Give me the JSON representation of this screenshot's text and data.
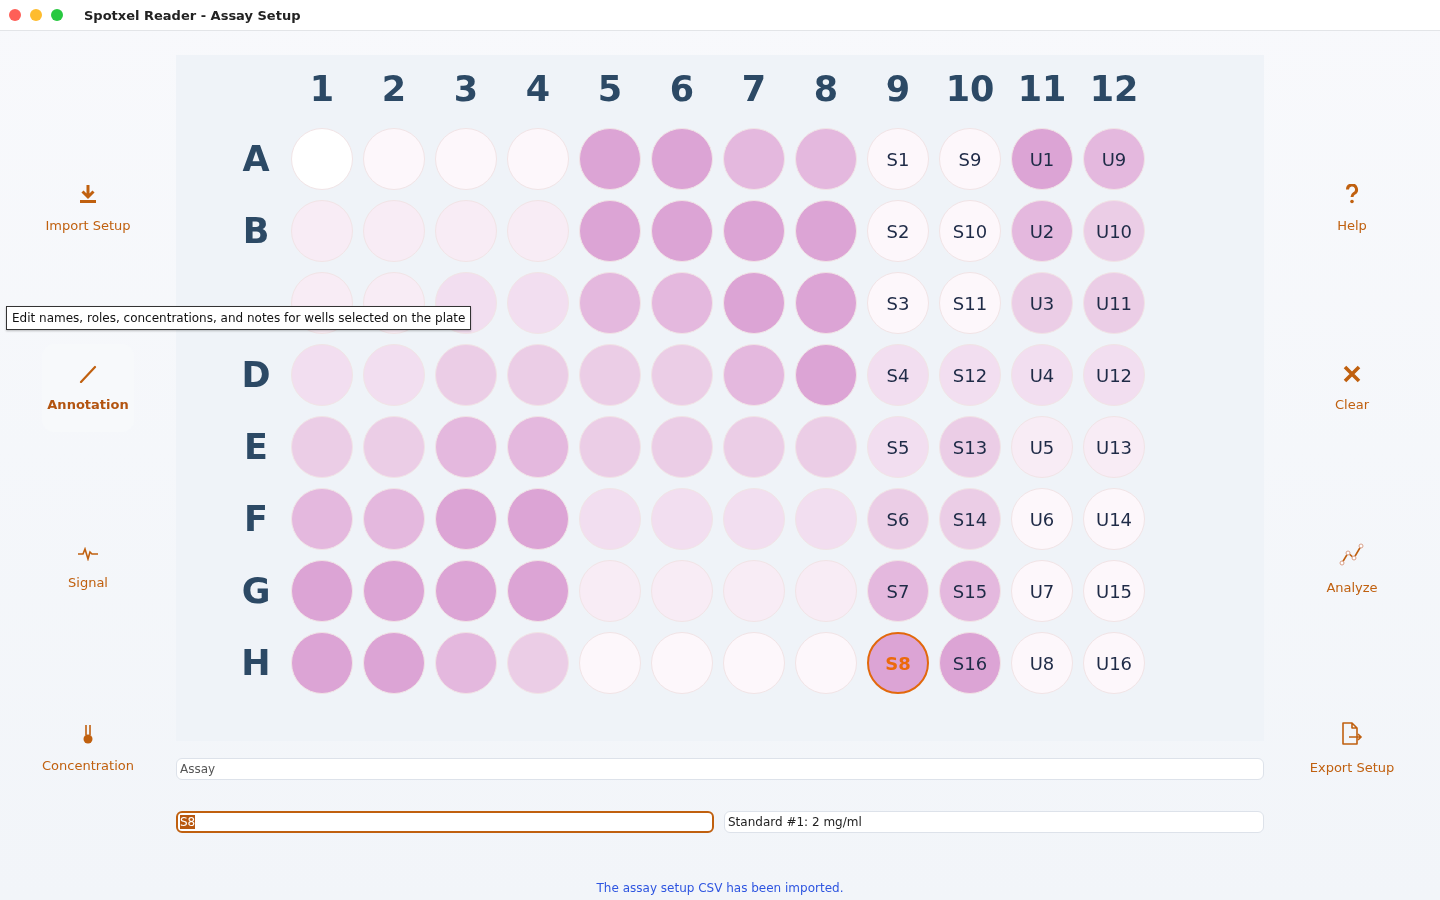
{
  "window": {
    "title": "Spotxel Reader - Assay Setup"
  },
  "left_sidebar": [
    {
      "label": "Import Setup",
      "selected": false
    },
    {
      "label": "Annotation",
      "selected": true
    },
    {
      "label": "Signal",
      "selected": false
    },
    {
      "label": "Concentration",
      "selected": false
    }
  ],
  "right_sidebar": [
    {
      "label": "Help",
      "selected": false
    },
    {
      "label": "Clear",
      "selected": false
    },
    {
      "label": "Analyze",
      "selected": false
    },
    {
      "label": "Export Setup",
      "selected": false
    }
  ],
  "plate": {
    "columns": [
      "1",
      "2",
      "3",
      "4",
      "5",
      "6",
      "7",
      "8",
      "9",
      "10",
      "11",
      "12"
    ],
    "rows": [
      {
        "label": "A",
        "wells": [
          {
            "color": "#ffffff",
            "selected": false
          },
          {
            "color": "#fdf7fb",
            "selected": false
          },
          {
            "color": "#fdf7fb",
            "selected": false
          },
          {
            "color": "#fdf7fb",
            "selected": false
          },
          {
            "color": "#dca4d5",
            "selected": false
          },
          {
            "color": "#dca4d5",
            "selected": false
          },
          {
            "color": "#e4b8de",
            "selected": false
          },
          {
            "color": "#e4b8de",
            "selected": false
          },
          {
            "label": "S1",
            "color": "#fdf7fb",
            "selected": false
          },
          {
            "label": "S9",
            "color": "#fdf7fb",
            "selected": false
          },
          {
            "label": "U1",
            "color": "#dca4d5",
            "selected": false
          },
          {
            "label": "U9",
            "color": "#e4b8de",
            "selected": false
          }
        ]
      },
      {
        "label": "B",
        "wells": [
          {
            "color": "#f8ecf5",
            "selected": false
          },
          {
            "color": "#f8ecf5",
            "selected": false
          },
          {
            "color": "#f8ecf5",
            "selected": false
          },
          {
            "color": "#f8ecf5",
            "selected": false
          },
          {
            "color": "#dca4d5",
            "selected": false
          },
          {
            "color": "#dca4d5",
            "selected": false
          },
          {
            "color": "#dca4d5",
            "selected": false
          },
          {
            "color": "#dca4d5",
            "selected": false
          },
          {
            "label": "S2",
            "color": "#fdf7fb",
            "selected": false
          },
          {
            "label": "S10",
            "color": "#fdf7fb",
            "selected": false
          },
          {
            "label": "U2",
            "color": "#e4b8de",
            "selected": false
          },
          {
            "label": "U10",
            "color": "#ebcde6",
            "selected": false
          }
        ]
      },
      {
        "wells": [
          {
            "color": "#f8ecf5",
            "selected": false
          },
          {
            "color": "#f8ecf5",
            "selected": false
          },
          {
            "color": "#f2def0",
            "selected": false
          },
          {
            "color": "#f2def0",
            "selected": false
          },
          {
            "color": "#e4b8de",
            "selected": false
          },
          {
            "color": "#e4b8de",
            "selected": false
          },
          {
            "color": "#dca4d5",
            "selected": false
          },
          {
            "color": "#dca4d5",
            "selected": false
          },
          {
            "label": "S3",
            "color": "#fdf7fb",
            "selected": false
          },
          {
            "label": "S11",
            "color": "#fdf7fb",
            "selected": false
          },
          {
            "label": "U3",
            "color": "#ebcde6",
            "selected": false
          },
          {
            "label": "U11",
            "color": "#ebcde6",
            "selected": false
          }
        ]
      },
      {
        "label": "D",
        "wells": [
          {
            "color": "#f2def0",
            "selected": false
          },
          {
            "color": "#f2def0",
            "selected": false
          },
          {
            "color": "#ebcde6",
            "selected": false
          },
          {
            "color": "#ebcde6",
            "selected": false
          },
          {
            "color": "#ebcde6",
            "selected": false
          },
          {
            "color": "#ebcde6",
            "selected": false
          },
          {
            "color": "#e4b8de",
            "selected": false
          },
          {
            "color": "#dca4d5",
            "selected": false
          },
          {
            "label": "S4",
            "color": "#f2def0",
            "selected": false
          },
          {
            "label": "S12",
            "color": "#f2def0",
            "selected": false
          },
          {
            "label": "U4",
            "color": "#f2def0",
            "selected": false
          },
          {
            "label": "U12",
            "color": "#f2def0",
            "selected": false
          }
        ]
      },
      {
        "label": "E",
        "wells": [
          {
            "color": "#ebcde6",
            "selected": false
          },
          {
            "color": "#ebcde6",
            "selected": false
          },
          {
            "color": "#e4b8de",
            "selected": false
          },
          {
            "color": "#e4b8de",
            "selected": false
          },
          {
            "color": "#ebcde6",
            "selected": false
          },
          {
            "color": "#ebcde6",
            "selected": false
          },
          {
            "color": "#ebcde6",
            "selected": false
          },
          {
            "color": "#ebcde6",
            "selected": false
          },
          {
            "label": "S5",
            "color": "#f2def0",
            "selected": false
          },
          {
            "label": "S13",
            "color": "#ebcde6",
            "selected": false
          },
          {
            "label": "U5",
            "color": "#f8ecf5",
            "selected": false
          },
          {
            "label": "U13",
            "color": "#f8ecf5",
            "selected": false
          }
        ]
      },
      {
        "label": "F",
        "wells": [
          {
            "color": "#e4b8de",
            "selected": false
          },
          {
            "color": "#e4b8de",
            "selected": false
          },
          {
            "color": "#dca4d5",
            "selected": false
          },
          {
            "color": "#dca4d5",
            "selected": false
          },
          {
            "color": "#f2def0",
            "selected": false
          },
          {
            "color": "#f2def0",
            "selected": false
          },
          {
            "color": "#f2def0",
            "selected": false
          },
          {
            "color": "#f2def0",
            "selected": false
          },
          {
            "label": "S6",
            "color": "#ebcde6",
            "selected": false
          },
          {
            "label": "S14",
            "color": "#ebcde6",
            "selected": false
          },
          {
            "label": "U6",
            "color": "#fdf7fb",
            "selected": false
          },
          {
            "label": "U14",
            "color": "#fdf7fb",
            "selected": false
          }
        ]
      },
      {
        "label": "G",
        "wells": [
          {
            "color": "#dca4d5",
            "selected": false
          },
          {
            "color": "#dca4d5",
            "selected": false
          },
          {
            "color": "#dca4d5",
            "selected": false
          },
          {
            "color": "#dca4d5",
            "selected": false
          },
          {
            "color": "#f8ecf5",
            "selected": false
          },
          {
            "color": "#f8ecf5",
            "selected": false
          },
          {
            "color": "#f8ecf5",
            "selected": false
          },
          {
            "color": "#f8ecf5",
            "selected": false
          },
          {
            "label": "S7",
            "color": "#e4b8de",
            "selected": false
          },
          {
            "label": "S15",
            "color": "#e4b8de",
            "selected": false
          },
          {
            "label": "U7",
            "color": "#fdf7fb",
            "selected": false
          },
          {
            "label": "U15",
            "color": "#fdf7fb",
            "selected": false
          }
        ]
      },
      {
        "label": "H",
        "wells": [
          {
            "color": "#dca4d5",
            "selected": false
          },
          {
            "color": "#dca4d5",
            "selected": false
          },
          {
            "color": "#e4b8de",
            "selected": false
          },
          {
            "color": "#ebcde6",
            "selected": false
          },
          {
            "color": "#fdf7fb",
            "selected": false
          },
          {
            "color": "#fdf7fb",
            "selected": false
          },
          {
            "color": "#fdf7fb",
            "selected": false
          },
          {
            "color": "#fdf7fb",
            "selected": false
          },
          {
            "label": "S8",
            "color": "#dca4d5",
            "selected": true
          },
          {
            "label": "S16",
            "color": "#dca4d5",
            "selected": false
          },
          {
            "label": "U8",
            "color": "#fdf7fb",
            "selected": false
          },
          {
            "label": "U16",
            "color": "#fdf7fb",
            "selected": false
          }
        ]
      }
    ]
  },
  "assay_field": {
    "placeholder": "Assay"
  },
  "well_name_field": {
    "value": "S8",
    "focused": true
  },
  "well_note_field": {
    "value": "Standard #1: 2 mg/ml"
  },
  "tooltip": {
    "text": "Edit names, roles, concentrations, and notes for wells selected on the plate"
  },
  "status_message": "The assay setup CSV has been imported."
}
